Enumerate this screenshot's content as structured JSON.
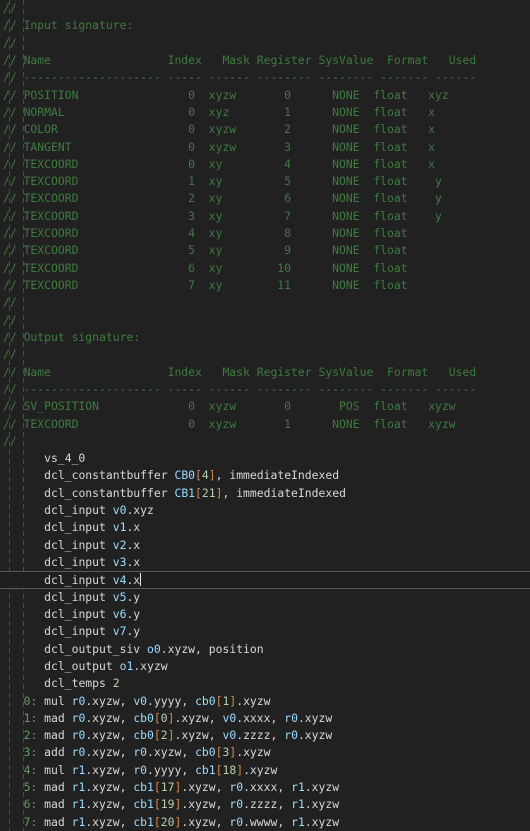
{
  "editor": {
    "background": "#212121",
    "comment_color": "#3f7a3f",
    "code_color": "#d8d8d8",
    "register_color": "#9cdcfe",
    "bracket_color": "#d4884a",
    "number_color": "#b5cea8",
    "linenum_color": "#5f9e5f",
    "current_line_border": "#5a5a5a"
  },
  "input_signature": {
    "section_label": "// Input signature:",
    "blank_comment": "//",
    "header": "// Name                 Index   Mask Register SysValue  Format   Used",
    "separator": "// -------------------- ----- ------ -------- -------- ------- ------",
    "columns": [
      "Name",
      "Index",
      "Mask",
      "Register",
      "SysValue",
      "Format",
      "Used"
    ],
    "rows": [
      {
        "name": "POSITION",
        "index": "0",
        "mask": "xyzw",
        "register": "0",
        "sysvalue": "NONE",
        "format": "float",
        "used": "xyz"
      },
      {
        "name": "NORMAL",
        "index": "0",
        "mask": "xyz",
        "register": "1",
        "sysvalue": "NONE",
        "format": "float",
        "used": "x"
      },
      {
        "name": "COLOR",
        "index": "0",
        "mask": "xyzw",
        "register": "2",
        "sysvalue": "NONE",
        "format": "float",
        "used": "x"
      },
      {
        "name": "TANGENT",
        "index": "0",
        "mask": "xyzw",
        "register": "3",
        "sysvalue": "NONE",
        "format": "float",
        "used": "x"
      },
      {
        "name": "TEXCOORD",
        "index": "0",
        "mask": "xy",
        "register": "4",
        "sysvalue": "NONE",
        "format": "float",
        "used": "x"
      },
      {
        "name": "TEXCOORD",
        "index": "1",
        "mask": "xy",
        "register": "5",
        "sysvalue": "NONE",
        "format": "float",
        "used": " y"
      },
      {
        "name": "TEXCOORD",
        "index": "2",
        "mask": "xy",
        "register": "6",
        "sysvalue": "NONE",
        "format": "float",
        "used": " y"
      },
      {
        "name": "TEXCOORD",
        "index": "3",
        "mask": "xy",
        "register": "7",
        "sysvalue": "NONE",
        "format": "float",
        "used": " y"
      },
      {
        "name": "TEXCOORD",
        "index": "4",
        "mask": "xy",
        "register": "8",
        "sysvalue": "NONE",
        "format": "float",
        "used": ""
      },
      {
        "name": "TEXCOORD",
        "index": "5",
        "mask": "xy",
        "register": "9",
        "sysvalue": "NONE",
        "format": "float",
        "used": ""
      },
      {
        "name": "TEXCOORD",
        "index": "6",
        "mask": "xy",
        "register": "10",
        "sysvalue": "NONE",
        "format": "float",
        "used": ""
      },
      {
        "name": "TEXCOORD",
        "index": "7",
        "mask": "xy",
        "register": "11",
        "sysvalue": "NONE",
        "format": "float",
        "used": ""
      }
    ]
  },
  "output_signature": {
    "section_label": "// Output signature:",
    "header": "// Name                 Index   Mask Register SysValue  Format   Used",
    "separator": "// -------------------- ----- ------ -------- -------- ------- ------",
    "rows": [
      {
        "name": "SV_POSITION",
        "index": "0",
        "mask": "xyzw",
        "register": "0",
        "sysvalue": "POS",
        "format": "float",
        "used": "xyzw"
      },
      {
        "name": "TEXCOORD",
        "index": "0",
        "mask": "xyzw",
        "register": "1",
        "sysvalue": "NONE",
        "format": "float",
        "used": "xyzw"
      }
    ]
  },
  "shader": {
    "profile": "vs_4_0",
    "declarations": [
      {
        "text": "dcl_constantbuffer CB0[4], immediateIndexed",
        "kw": "dcl_constantbuffer ",
        "reg": "CB0",
        "idx": "4",
        "tail": ", immediateIndexed"
      },
      {
        "text": "dcl_constantbuffer CB1[21], immediateIndexed",
        "kw": "dcl_constantbuffer ",
        "reg": "CB1",
        "idx": "21",
        "tail": ", immediateIndexed"
      },
      {
        "text": "dcl_input v0.xyz",
        "kw": "dcl_input ",
        "reg": "v0",
        "swz": ".xyz"
      },
      {
        "text": "dcl_input v1.x",
        "kw": "dcl_input ",
        "reg": "v1",
        "swz": ".x"
      },
      {
        "text": "dcl_input v2.x",
        "kw": "dcl_input ",
        "reg": "v2",
        "swz": ".x"
      },
      {
        "text": "dcl_input v3.x",
        "kw": "dcl_input ",
        "reg": "v3",
        "swz": ".x"
      },
      {
        "text": "dcl_input v4.x",
        "kw": "dcl_input ",
        "reg": "v4",
        "swz": ".x",
        "current": true
      },
      {
        "text": "dcl_input v5.y",
        "kw": "dcl_input ",
        "reg": "v5",
        "swz": ".y"
      },
      {
        "text": "dcl_input v6.y",
        "kw": "dcl_input ",
        "reg": "v6",
        "swz": ".y"
      },
      {
        "text": "dcl_input v7.y",
        "kw": "dcl_input ",
        "reg": "v7",
        "swz": ".y"
      },
      {
        "text": "dcl_output_siv o0.xyzw, position",
        "kw": "dcl_output_siv ",
        "reg": "o0",
        "swz": ".xyzw",
        "tail": ", position"
      },
      {
        "text": "dcl_output o1.xyzw",
        "kw": "dcl_output ",
        "reg": "o1",
        "swz": ".xyzw"
      },
      {
        "text": "dcl_temps 2",
        "kw": "dcl_temps ",
        "num": "2"
      }
    ],
    "instructions": [
      {
        "n": "0",
        "op": "mul",
        "args": "r0.xyzw, v0.yyyy, cb0[1].xyzw"
      },
      {
        "n": "1",
        "op": "mad",
        "args": "r0.xyzw, cb0[0].xyzw, v0.xxxx, r0.xyzw"
      },
      {
        "n": "2",
        "op": "mad",
        "args": "r0.xyzw, cb0[2].xyzw, v0.zzzz, r0.xyzw"
      },
      {
        "n": "3",
        "op": "add",
        "args": "r0.xyzw, r0.xyzw, cb0[3].xyzw"
      },
      {
        "n": "4",
        "op": "mul",
        "args": "r1.xyzw, r0.yyyy, cb1[18].xyzw"
      },
      {
        "n": "5",
        "op": "mad",
        "args": "r1.xyzw, cb1[17].xyzw, r0.xxxx, r1.xyzw"
      },
      {
        "n": "6",
        "op": "mad",
        "args": "r1.xyzw, cb1[19].xyzw, r0.zzzz, r1.xyzw"
      },
      {
        "n": "7",
        "op": "mad",
        "args": "r1.xyzw, cb1[20].xyzw, r0.wwww, r1.xyzw"
      }
    ],
    "cursor_line_index": 6
  }
}
